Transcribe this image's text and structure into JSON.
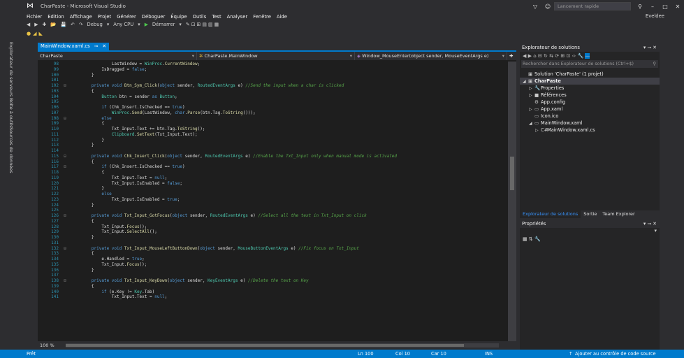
{
  "window": {
    "title": "CharPaste - Microsoft Visual Studio",
    "quick_launch_placeholder": "Lancement rapide",
    "user": "Eveldee"
  },
  "menu": [
    "Fichier",
    "Edition",
    "Affichage",
    "Projet",
    "Générer",
    "Déboguer",
    "Équipe",
    "Outils",
    "Test",
    "Analyser",
    "Fenêtre",
    "Aide"
  ],
  "toolbar": {
    "config": "Debug",
    "platform": "Any CPU",
    "start_label": "Démarrer"
  },
  "left_tabs": [
    "Explorateur de serveurs",
    "Boîte à outils",
    "Sources de données"
  ],
  "editor": {
    "tab_label": "MainWindow.xaml.cs",
    "nav_project": "CharPaste",
    "nav_class": "CharPaste.MainWindow",
    "nav_member": "Window_MouseEnter(object sender, MouseEventArgs e)",
    "zoom": "100 %",
    "lines": [
      {
        "n": "98",
        "g": "",
        "c": [
          [
            "txt",
            "                LastWindow = "
          ],
          [
            "ty",
            "WinProc"
          ],
          [
            "txt",
            "."
          ],
          [
            "mb",
            "CurrentWindow"
          ],
          [
            "txt",
            ";"
          ]
        ]
      },
      {
        "n": "99",
        "g": "",
        "c": [
          [
            "txt",
            "            IsDragged = "
          ],
          [
            "kw",
            "false"
          ],
          [
            "txt",
            ";"
          ]
        ]
      },
      {
        "n": "100",
        "g": "",
        "c": [
          [
            "txt",
            "        }"
          ]
        ]
      },
      {
        "n": "101",
        "g": "",
        "c": []
      },
      {
        "n": "102",
        "g": "⊟",
        "c": [
          [
            "kw",
            "        private void "
          ],
          [
            "mb",
            "Btn_Sym_Click"
          ],
          [
            "txt",
            "("
          ],
          [
            "kw",
            "object"
          ],
          [
            "txt",
            " sender, "
          ],
          [
            "ty",
            "RoutedEventArgs"
          ],
          [
            "txt",
            " e) "
          ],
          [
            "cm",
            "//Send the input when a char is clicked"
          ]
        ]
      },
      {
        "n": "103",
        "g": "",
        "c": [
          [
            "txt",
            "        {"
          ]
        ]
      },
      {
        "n": "104",
        "g": "",
        "c": [
          [
            "txt",
            "            "
          ],
          [
            "ty",
            "Button"
          ],
          [
            "txt",
            " btn = sender "
          ],
          [
            "kw",
            "as"
          ],
          [
            "txt",
            " "
          ],
          [
            "ty",
            "Button"
          ],
          [
            "txt",
            ";"
          ]
        ]
      },
      {
        "n": "105",
        "g": "",
        "c": []
      },
      {
        "n": "106",
        "g": "",
        "c": [
          [
            "kw",
            "            if"
          ],
          [
            "txt",
            " (Chk_Insert.IsChecked == "
          ],
          [
            "kw",
            "true"
          ],
          [
            "txt",
            ")"
          ]
        ]
      },
      {
        "n": "107",
        "g": "",
        "c": [
          [
            "txt",
            "                "
          ],
          [
            "ty",
            "WinProc"
          ],
          [
            "txt",
            "."
          ],
          [
            "mb",
            "Send"
          ],
          [
            "txt",
            "(LastWindow, "
          ],
          [
            "kw",
            "char"
          ],
          [
            "txt",
            "."
          ],
          [
            "mb",
            "Parse"
          ],
          [
            "txt",
            "(btn.Tag."
          ],
          [
            "mb",
            "ToString"
          ],
          [
            "txt",
            "()));"
          ]
        ]
      },
      {
        "n": "108",
        "g": "⊟",
        "c": [
          [
            "kw",
            "            else"
          ]
        ]
      },
      {
        "n": "109",
        "g": "",
        "c": [
          [
            "txt",
            "            {"
          ]
        ]
      },
      {
        "n": "110",
        "g": "",
        "c": [
          [
            "txt",
            "                Txt_Input.Text += btn.Tag."
          ],
          [
            "mb",
            "ToString"
          ],
          [
            "txt",
            "();"
          ]
        ]
      },
      {
        "n": "111",
        "g": "",
        "c": [
          [
            "txt",
            "                "
          ],
          [
            "ty",
            "Clipboard"
          ],
          [
            "txt",
            "."
          ],
          [
            "mb",
            "SetText"
          ],
          [
            "txt",
            "(Txt_Input.Text);"
          ]
        ]
      },
      {
        "n": "112",
        "g": "",
        "c": [
          [
            "txt",
            "            }"
          ]
        ]
      },
      {
        "n": "113",
        "g": "",
        "c": [
          [
            "txt",
            "        }"
          ]
        ]
      },
      {
        "n": "114",
        "g": "",
        "c": []
      },
      {
        "n": "115",
        "g": "⊟",
        "c": [
          [
            "kw",
            "        private void "
          ],
          [
            "mb",
            "Chk_Insert_Click"
          ],
          [
            "txt",
            "("
          ],
          [
            "kw",
            "object"
          ],
          [
            "txt",
            " sender, "
          ],
          [
            "ty",
            "RoutedEventArgs"
          ],
          [
            "txt",
            " e) "
          ],
          [
            "cm",
            "//Enable the Txt_Input only when manual mode is activated"
          ]
        ]
      },
      {
        "n": "116",
        "g": "",
        "c": [
          [
            "txt",
            "        {"
          ]
        ]
      },
      {
        "n": "117",
        "g": "⊟",
        "c": [
          [
            "kw",
            "            if"
          ],
          [
            "txt",
            " (Chk_Insert.IsChecked == "
          ],
          [
            "kw",
            "true"
          ],
          [
            "txt",
            ")"
          ]
        ]
      },
      {
        "n": "118",
        "g": "",
        "c": [
          [
            "txt",
            "            {"
          ]
        ]
      },
      {
        "n": "119",
        "g": "",
        "c": [
          [
            "txt",
            "                Txt_Input.Text = "
          ],
          [
            "kw",
            "null"
          ],
          [
            "txt",
            ";"
          ]
        ]
      },
      {
        "n": "120",
        "g": "",
        "c": [
          [
            "txt",
            "                Txt_Input.IsEnabled = "
          ],
          [
            "kw",
            "false"
          ],
          [
            "txt",
            ";"
          ]
        ]
      },
      {
        "n": "121",
        "g": "",
        "c": [
          [
            "txt",
            "            }"
          ]
        ]
      },
      {
        "n": "122",
        "g": "",
        "c": [
          [
            "kw",
            "            else"
          ]
        ]
      },
      {
        "n": "123",
        "g": "",
        "c": [
          [
            "txt",
            "                Txt_Input.IsEnabled = "
          ],
          [
            "kw",
            "true"
          ],
          [
            "txt",
            ";"
          ]
        ]
      },
      {
        "n": "124",
        "g": "",
        "c": [
          [
            "txt",
            "        }"
          ]
        ]
      },
      {
        "n": "125",
        "g": "",
        "c": []
      },
      {
        "n": "126",
        "g": "⊟",
        "c": [
          [
            "kw",
            "        private void "
          ],
          [
            "mb",
            "Txt_Input_GotFocus"
          ],
          [
            "txt",
            "("
          ],
          [
            "kw",
            "object"
          ],
          [
            "txt",
            " sender, "
          ],
          [
            "ty",
            "RoutedEventArgs"
          ],
          [
            "txt",
            " e) "
          ],
          [
            "cm",
            "//Select all the text in Txt_Input on click"
          ]
        ]
      },
      {
        "n": "127",
        "g": "",
        "c": [
          [
            "txt",
            "        {"
          ]
        ]
      },
      {
        "n": "128",
        "g": "",
        "c": [
          [
            "txt",
            "            Txt_Input."
          ],
          [
            "mb",
            "Focus"
          ],
          [
            "txt",
            "();"
          ]
        ]
      },
      {
        "n": "129",
        "g": "",
        "c": [
          [
            "txt",
            "            Txt_Input."
          ],
          [
            "mb",
            "SelectAll"
          ],
          [
            "txt",
            "();"
          ]
        ]
      },
      {
        "n": "130",
        "g": "",
        "c": [
          [
            "txt",
            "        }"
          ]
        ]
      },
      {
        "n": "131",
        "g": "",
        "c": []
      },
      {
        "n": "132",
        "g": "⊟",
        "c": [
          [
            "kw",
            "        private void "
          ],
          [
            "mb",
            "Txt_Input_MouseLeftButtonDown"
          ],
          [
            "txt",
            "("
          ],
          [
            "kw",
            "object"
          ],
          [
            "txt",
            " sender, "
          ],
          [
            "ty",
            "MouseButtonEventArgs"
          ],
          [
            "txt",
            " e) "
          ],
          [
            "cm",
            "//Fix focus on Txt_Input"
          ]
        ]
      },
      {
        "n": "133",
        "g": "",
        "c": [
          [
            "txt",
            "        {"
          ]
        ]
      },
      {
        "n": "134",
        "g": "",
        "c": [
          [
            "txt",
            "            e.Handled = "
          ],
          [
            "kw",
            "true"
          ],
          [
            "txt",
            ";"
          ]
        ]
      },
      {
        "n": "135",
        "g": "",
        "c": [
          [
            "txt",
            "            Txt_Input."
          ],
          [
            "mb",
            "Focus"
          ],
          [
            "txt",
            "();"
          ]
        ]
      },
      {
        "n": "136",
        "g": "",
        "c": [
          [
            "txt",
            "        }"
          ]
        ]
      },
      {
        "n": "137",
        "g": "",
        "c": []
      },
      {
        "n": "138",
        "g": "⊟",
        "c": [
          [
            "kw",
            "        private void "
          ],
          [
            "mb",
            "Txt_Input_KeyDown"
          ],
          [
            "txt",
            "("
          ],
          [
            "kw",
            "object"
          ],
          [
            "txt",
            " sender, "
          ],
          [
            "ty",
            "KeyEventArgs"
          ],
          [
            "txt",
            " e) "
          ],
          [
            "cm",
            "//Delete the text on Key"
          ]
        ]
      },
      {
        "n": "139",
        "g": "",
        "c": [
          [
            "txt",
            "        {"
          ]
        ]
      },
      {
        "n": "140",
        "g": "",
        "c": [
          [
            "kw",
            "            if"
          ],
          [
            "txt",
            " (e.Key != "
          ],
          [
            "ty",
            "Key"
          ],
          [
            "txt",
            ".Tab)"
          ]
        ]
      },
      {
        "n": "141",
        "g": "",
        "c": [
          [
            "txt",
            "                Txt_Input.Text = "
          ],
          [
            "kw",
            "null"
          ],
          [
            "txt",
            ";"
          ]
        ]
      }
    ]
  },
  "solution_explorer": {
    "title": "Explorateur de solutions",
    "search_placeholder": "Rechercher dans Explorateur de solutions (Ctrl+$)",
    "nodes": [
      {
        "label": "Solution 'CharPaste' (1 projet)",
        "arrow": "",
        "icon": "▣",
        "indent": 0,
        "sel": false
      },
      {
        "label": "CharPaste",
        "arrow": "◢",
        "icon": "▣",
        "indent": 0,
        "sel": true
      },
      {
        "label": "Properties",
        "arrow": "▷",
        "icon": "🔧",
        "indent": 1,
        "sel": false
      },
      {
        "label": "Références",
        "arrow": "▷",
        "icon": "■",
        "indent": 1,
        "sel": false
      },
      {
        "label": "App.config",
        "arrow": "",
        "icon": "⚙",
        "indent": 1,
        "sel": false
      },
      {
        "label": "App.xaml",
        "arrow": "▷",
        "icon": "▭",
        "indent": 1,
        "sel": false
      },
      {
        "label": "Icon.ico",
        "arrow": "",
        "icon": "▭",
        "indent": 1,
        "sel": false
      },
      {
        "label": "MainWindow.xaml",
        "arrow": "◢",
        "icon": "▭",
        "indent": 1,
        "sel": false
      },
      {
        "label": "MainWindow.xaml.cs",
        "arrow": "▷",
        "icon": "C#",
        "indent": 2,
        "sel": false
      }
    ]
  },
  "bottom_tabs": [
    "Explorateur de solutions",
    "Sortie",
    "Team Explorer"
  ],
  "properties": {
    "title": "Propriétés"
  },
  "status": {
    "left": "Prêt",
    "ln": "Ln 100",
    "col": "Col 10",
    "car": "Car 10",
    "ins": "INS",
    "source_control": "Ajouter au contrôle de code source"
  },
  "colors": {
    "accent": "#007acc",
    "keyword": "#569cd6",
    "type": "#4ec9b0",
    "comment": "#57a64a"
  }
}
